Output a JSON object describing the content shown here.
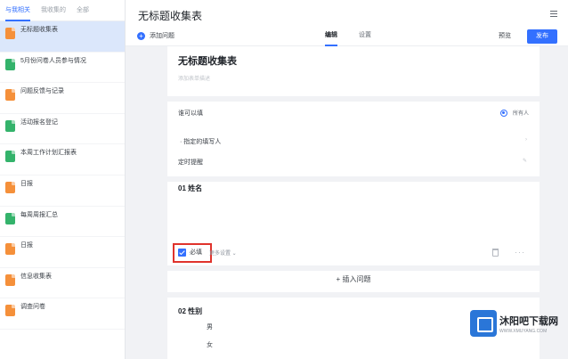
{
  "sidebar": {
    "tabs": [
      "与我相关",
      "我收集的",
      "全部"
    ],
    "items": [
      {
        "title": "无标题收集表",
        "meta": "",
        "time": "",
        "color": "orange"
      },
      {
        "title": "5月份问卷人员参与情况",
        "meta": "",
        "time": "",
        "color": "green"
      },
      {
        "title": "问题反馈与记录",
        "meta": "",
        "time": "",
        "color": "orange"
      },
      {
        "title": "活动报名登记",
        "meta": "",
        "time": "",
        "color": "green"
      },
      {
        "title": "本周工作计划汇报表",
        "meta": "",
        "time": "",
        "color": "green"
      },
      {
        "title": "日报",
        "meta": "",
        "time": "",
        "color": "orange"
      },
      {
        "title": "每周周报汇总",
        "meta": "",
        "time": "",
        "color": "green"
      },
      {
        "title": "日报",
        "meta": "",
        "time": "",
        "color": "orange"
      },
      {
        "title": "信息收集表",
        "meta": "",
        "time": "",
        "color": "orange"
      },
      {
        "title": "调查问卷",
        "meta": "",
        "time": "",
        "color": "orange"
      }
    ]
  },
  "header": {
    "title": "无标题收集表"
  },
  "toolbar": {
    "add_question": "添加问题",
    "tab_edit": "编辑",
    "tab_settings": "设置",
    "preview": "预览",
    "publish": "发布"
  },
  "form": {
    "title": "无标题收集表",
    "description": "添加表单描述",
    "who_can_fill": "谁可以填",
    "who_can_fill_sub": "",
    "fill_mode": "所有人",
    "assigned_fillers": "· 指定的填写人",
    "timed_reminder": "定时提醒",
    "q1": {
      "title": "01  姓名"
    },
    "required_label": "必填",
    "more_settings": "更多设置",
    "insert_question": "插入问题",
    "q2": {
      "title": "02  性别",
      "options": [
        "男",
        "女"
      ]
    }
  },
  "watermark": {
    "name": "沐阳吧下载网",
    "url": "WWW.XMUYANG.COM"
  },
  "colors": {
    "accent": "#3370ff",
    "highlight": "#e0332c",
    "selected_row": "#dbe7fb"
  }
}
